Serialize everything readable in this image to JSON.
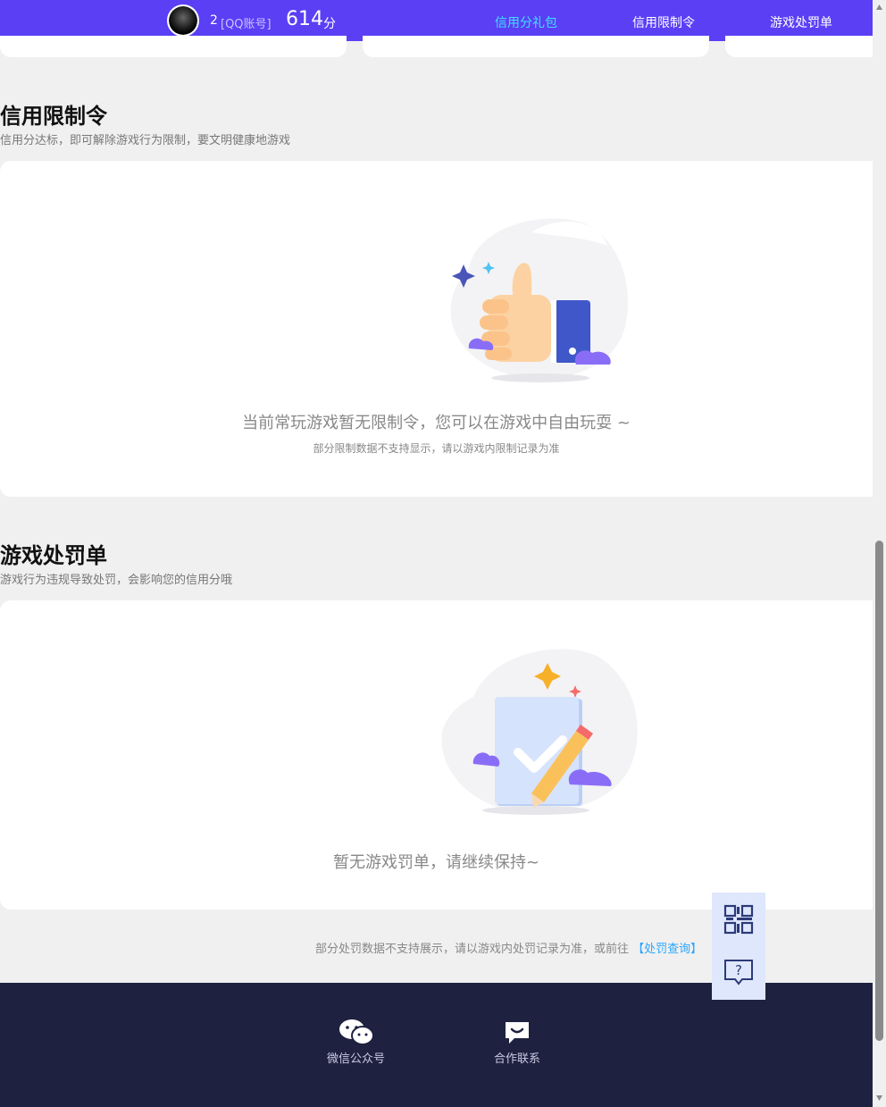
{
  "header": {
    "user_id": "2",
    "account_tag": "[QQ账号]",
    "score": "614",
    "score_unit": "分",
    "nav": [
      "信用分礼包",
      "信用限制令",
      "游戏处罚单"
    ]
  },
  "restriction": {
    "title": "信用限制令",
    "subtitle": "信用分达标，即可解除游戏行为限制，要文明健康地游戏",
    "empty_main": "当前常玩游戏暂无限制令，您可以在游戏中自由玩耍 ~",
    "empty_sub": "部分限制数据不支持显示，请以游戏内限制记录为准"
  },
  "penalty": {
    "title": "游戏处罚单",
    "subtitle": "游戏行为违规导致处罚，会影响您的信用分哦",
    "empty_main": "暂无游戏罚单，请继续保持~"
  },
  "footnote": {
    "text": "部分处罚数据不支持展示，请以游戏内处罚记录为准，或前往 ",
    "link": "【处罚查询】"
  },
  "footer": {
    "wechat_label": "微信公众号",
    "contact_label": "合作联系"
  },
  "colors": {
    "header_bg": "#5a3ff5",
    "nav_active": "#3fe0ff",
    "footer_bg": "#1e2140",
    "link": "#2aa5ff"
  }
}
